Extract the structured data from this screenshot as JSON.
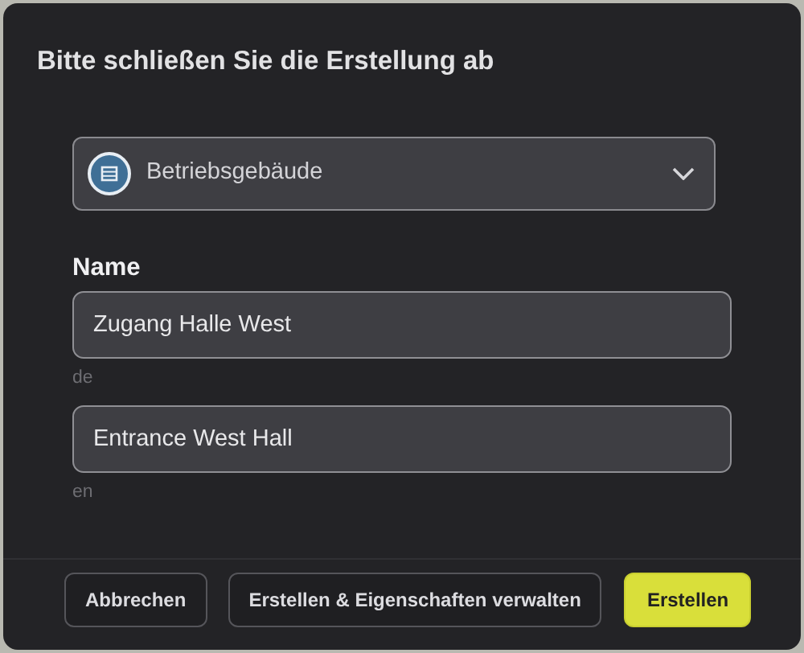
{
  "dialog": {
    "title": "Bitte schließen Sie die Erstellung ab"
  },
  "type_select": {
    "value": "Betriebsgebäude"
  },
  "name_section": {
    "label": "Name",
    "fields": [
      {
        "value": "Zugang Halle West",
        "language": "de"
      },
      {
        "value": "Entrance West Hall",
        "language": "en"
      }
    ]
  },
  "buttons": [
    {
      "label": "Abbrechen",
      "kind": "secondary"
    },
    {
      "label": "Erstellen & Eigenschaften verwalten",
      "kind": "secondary"
    },
    {
      "label": "Erstellen",
      "kind": "primary"
    }
  ]
}
